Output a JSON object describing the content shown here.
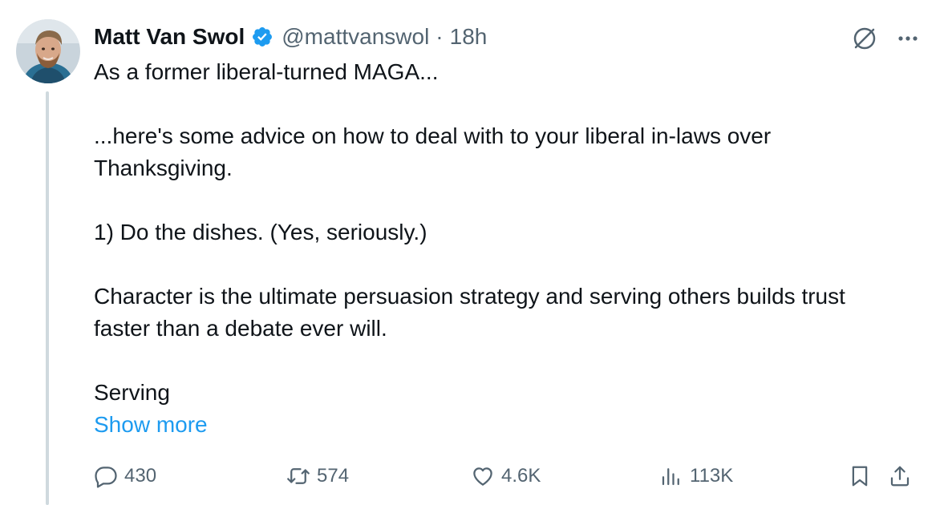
{
  "tweet": {
    "author_name": "Matt Van Swol",
    "handle": "@mattvanswol",
    "separator": "·",
    "timestamp": "18h",
    "lines": [
      "As a former liberal-turned MAGA...",
      "",
      "...here's some advice on how to deal with to your liberal in-laws over Thanksgiving.",
      "",
      "1) Do the dishes. (Yes, seriously.)",
      "",
      "Character is the ultimate persuasion strategy and serving others builds trust faster than a debate ever will.",
      "",
      "Serving"
    ],
    "show_more": "Show more"
  },
  "icons": {
    "verified": "verified-badge-icon",
    "grok": "grok-icon",
    "more": "more-dots-icon",
    "reply": "reply-icon",
    "repost": "repost-icon",
    "like": "heart-icon",
    "views": "views-chart-icon",
    "bookmark": "bookmark-icon",
    "share": "share-icon"
  },
  "colors": {
    "accent": "#1d9bf0",
    "text": "#0f1419",
    "muted": "#536471",
    "thread_line": "#cfd9de"
  },
  "actions": {
    "replies": "430",
    "reposts": "574",
    "likes": "4.6K",
    "views": "113K"
  }
}
